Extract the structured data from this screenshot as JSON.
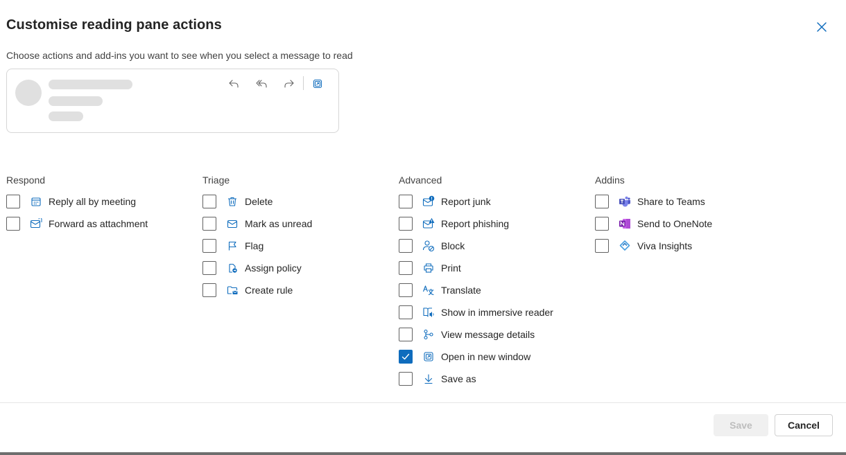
{
  "dialog": {
    "title": "Customise reading pane actions",
    "subtitle": "Choose actions and add-ins you want to see when you select a message to read"
  },
  "preview": {
    "buttons": [
      {
        "icon": "reply-icon"
      },
      {
        "icon": "reply-all-icon"
      },
      {
        "icon": "forward-icon"
      },
      {
        "icon": "open-in-new-window-icon"
      }
    ]
  },
  "columns": [
    {
      "heading": "Respond",
      "items": [
        {
          "label": "Reply all by meeting",
          "icon": "calendar-icon",
          "checked": false
        },
        {
          "label": "Forward as attachment",
          "icon": "mail-attachment-icon",
          "checked": false
        }
      ]
    },
    {
      "heading": "Triage",
      "items": [
        {
          "label": "Delete",
          "icon": "trash-icon",
          "checked": false
        },
        {
          "label": "Mark as unread",
          "icon": "mail-icon",
          "checked": false
        },
        {
          "label": "Flag",
          "icon": "flag-icon",
          "checked": false
        },
        {
          "label": "Assign policy",
          "icon": "policy-icon",
          "checked": false
        },
        {
          "label": "Create rule",
          "icon": "folder-rule-icon",
          "checked": false
        }
      ]
    },
    {
      "heading": "Advanced",
      "items": [
        {
          "label": "Report junk",
          "icon": "mail-warning-icon",
          "checked": false
        },
        {
          "label": "Report phishing",
          "icon": "mail-alert-icon",
          "checked": false
        },
        {
          "label": "Block",
          "icon": "person-block-icon",
          "checked": false
        },
        {
          "label": "Print",
          "icon": "print-icon",
          "checked": false
        },
        {
          "label": "Translate",
          "icon": "translate-icon",
          "checked": false
        },
        {
          "label": "Show in immersive reader",
          "icon": "immersive-reader-icon",
          "checked": false
        },
        {
          "label": "View message details",
          "icon": "message-details-icon",
          "checked": false
        },
        {
          "label": "Open in new window",
          "icon": "open-in-new-window-icon",
          "checked": true
        },
        {
          "label": "Save as",
          "icon": "download-icon",
          "checked": false
        }
      ]
    },
    {
      "heading": "Addins",
      "items": [
        {
          "label": "Share to Teams",
          "icon": "teams-icon",
          "checked": false
        },
        {
          "label": "Send to OneNote",
          "icon": "onenote-icon",
          "checked": false
        },
        {
          "label": "Viva Insights",
          "icon": "viva-insights-icon",
          "checked": false
        }
      ]
    }
  ],
  "footer": {
    "save_label": "Save",
    "cancel_label": "Cancel"
  },
  "colors": {
    "accent": "#0f6cbd",
    "teams": "#5b5fc7",
    "onenote": "#7719aa",
    "disabled_text": "#bdbdbd"
  }
}
